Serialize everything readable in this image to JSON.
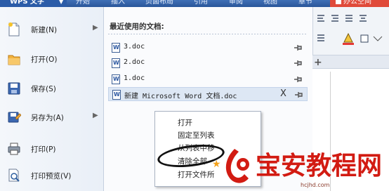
{
  "titlebar": {
    "app_name": "WPS 文字",
    "tabs": [
      "开始",
      "插入",
      "页面布局",
      "引用",
      "审阅",
      "视图",
      "章节"
    ],
    "office_space": "办公空间"
  },
  "left_menu": {
    "items": [
      {
        "label": "新建(N)",
        "icon": "new-document-icon",
        "has_submenu": true
      },
      {
        "label": "打开(O)",
        "icon": "open-folder-icon",
        "has_submenu": false
      },
      {
        "label": "保存(S)",
        "icon": "save-disk-icon",
        "has_submenu": false
      },
      {
        "label": "另存为(A)",
        "icon": "save-as-icon",
        "has_submenu": true
      },
      {
        "label": "打印(P)",
        "icon": "printer-icon",
        "has_submenu": false
      },
      {
        "label": "打印预览(V)",
        "icon": "print-preview-icon",
        "has_submenu": false
      }
    ]
  },
  "recent": {
    "heading": "最近使用的文档:",
    "documents": [
      {
        "name": "3.doc",
        "selected": false
      },
      {
        "name": "2.doc",
        "selected": false
      },
      {
        "name": "1.doc",
        "selected": false
      },
      {
        "name": "新建 Microsoft Word 文档.doc",
        "selected": true
      }
    ],
    "remove_symbol": "X"
  },
  "context_menu": {
    "items": [
      "打开",
      "固定至列表",
      "从列表中移",
      "清除全部",
      "打开文件所"
    ]
  },
  "watermark": {
    "logo_text": "宝安教程网",
    "sub_text": "hcjhd.com"
  },
  "colors": {
    "title_bar": "#2b5ca8",
    "office_space": "#e04a3a",
    "selected_row": "#dde7f4",
    "watermark": "#d21b12"
  }
}
